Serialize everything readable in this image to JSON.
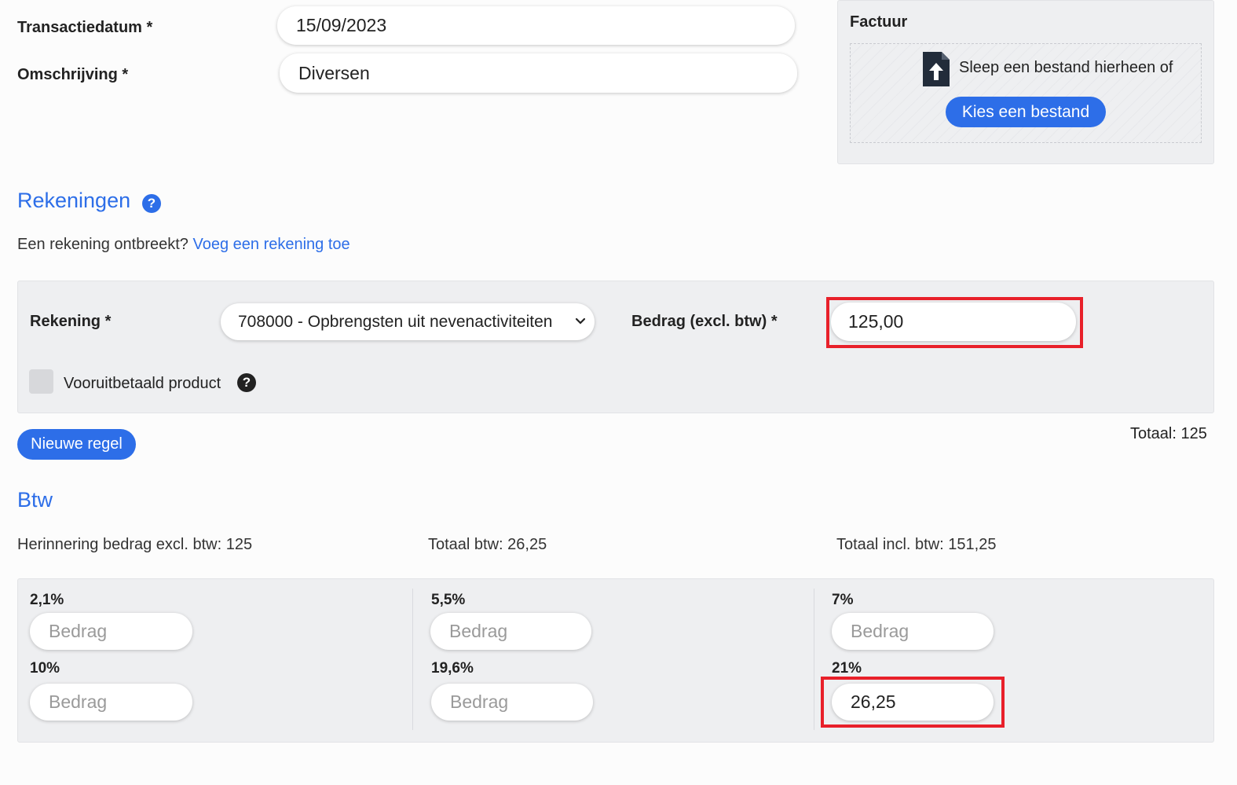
{
  "form": {
    "date_label": "Transactiedatum *",
    "date_value": "15/09/2023",
    "description_label": "Omschrijving *",
    "description_value": "Diversen"
  },
  "invoice": {
    "title": "Factuur",
    "drop_text": "Sleep een bestand hierheen of",
    "choose_button": "Kies een bestand"
  },
  "accounts": {
    "heading": "Rekeningen",
    "help": "?",
    "missing_text": "Een rekening ontbreekt?",
    "add_link": "Voeg een rekening toe",
    "account_label": "Rekening *",
    "account_selected": "708000 - Opbrengsten uit nevenactiviteiten",
    "amount_label": "Bedrag (excl. btw) *",
    "amount_value": "125,00",
    "prepaid_label": "Vooruitbetaald product",
    "new_line_button": "Nieuwe regel",
    "total": "Totaal: 125"
  },
  "vat": {
    "heading": "Btw",
    "reminder": "Herinnering bedrag excl. btw: 125",
    "total_vat": "Totaal btw: 26,25",
    "total_incl": "Totaal incl. btw: 151,25",
    "placeholder": "Bedrag",
    "rates": [
      {
        "rate": "2,1%",
        "value": ""
      },
      {
        "rate": "5,5%",
        "value": ""
      },
      {
        "rate": "7%",
        "value": ""
      },
      {
        "rate": "10%",
        "value": ""
      },
      {
        "rate": "19,6%",
        "value": ""
      },
      {
        "rate": "21%",
        "value": "26,25"
      }
    ]
  },
  "colors": {
    "accent": "#2d6ee8",
    "highlight": "#e8202a",
    "panel": "#eeeff1"
  }
}
